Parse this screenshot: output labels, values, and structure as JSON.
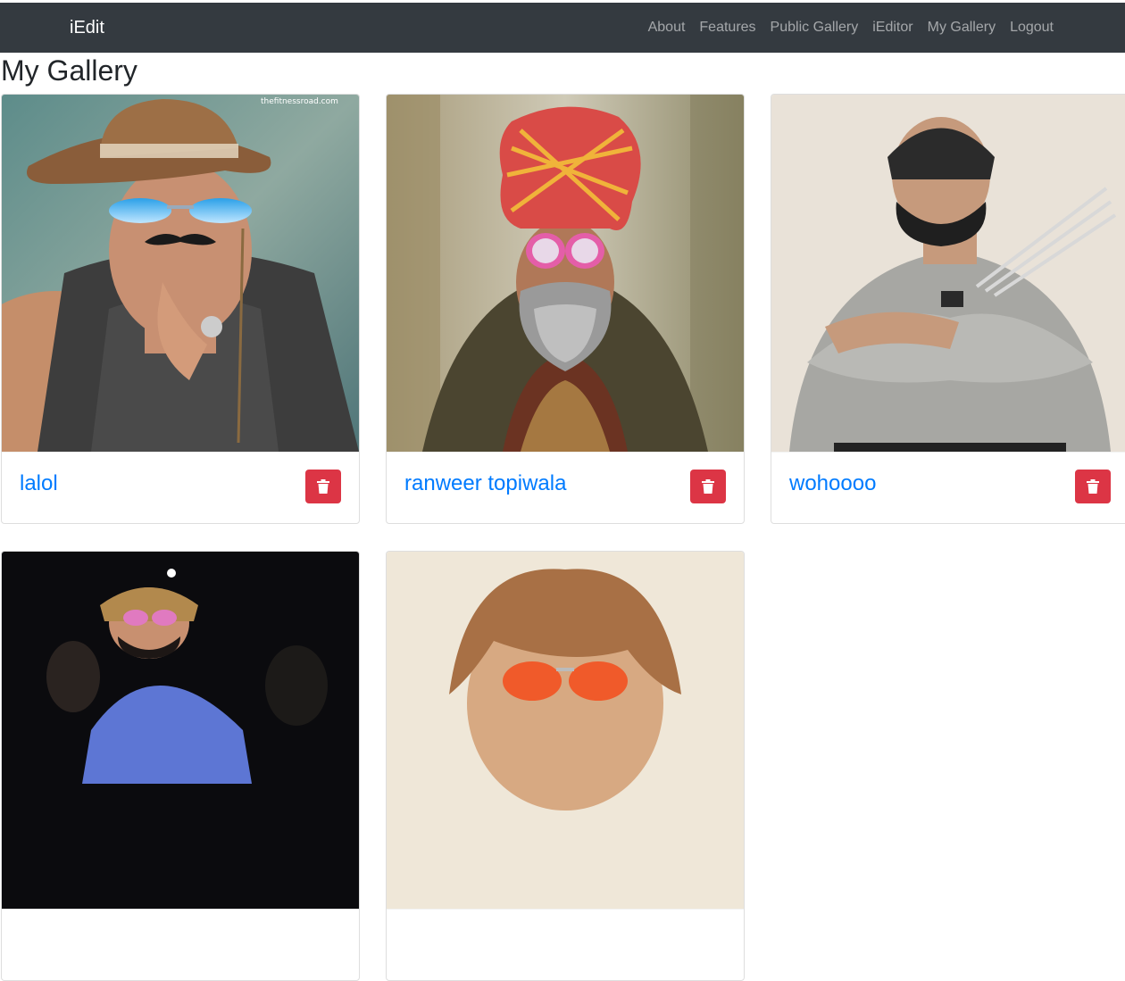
{
  "navbar": {
    "brand": "iEdit",
    "links": [
      "About",
      "Features",
      "Public Gallery",
      "iEditor",
      "My Gallery",
      "Logout"
    ]
  },
  "page": {
    "title": "My Gallery"
  },
  "gallery": {
    "cards": [
      {
        "title": "lalol",
        "watermark": "thefitnessroad.com"
      },
      {
        "title": "ranweer topiwala"
      },
      {
        "title": "wohoooo"
      },
      {
        "title": ""
      },
      {
        "title": ""
      }
    ],
    "delete_icon": "trash-icon"
  },
  "colors": {
    "navbar_bg": "#343a40",
    "link": "#007bff",
    "danger": "#dc3545"
  }
}
